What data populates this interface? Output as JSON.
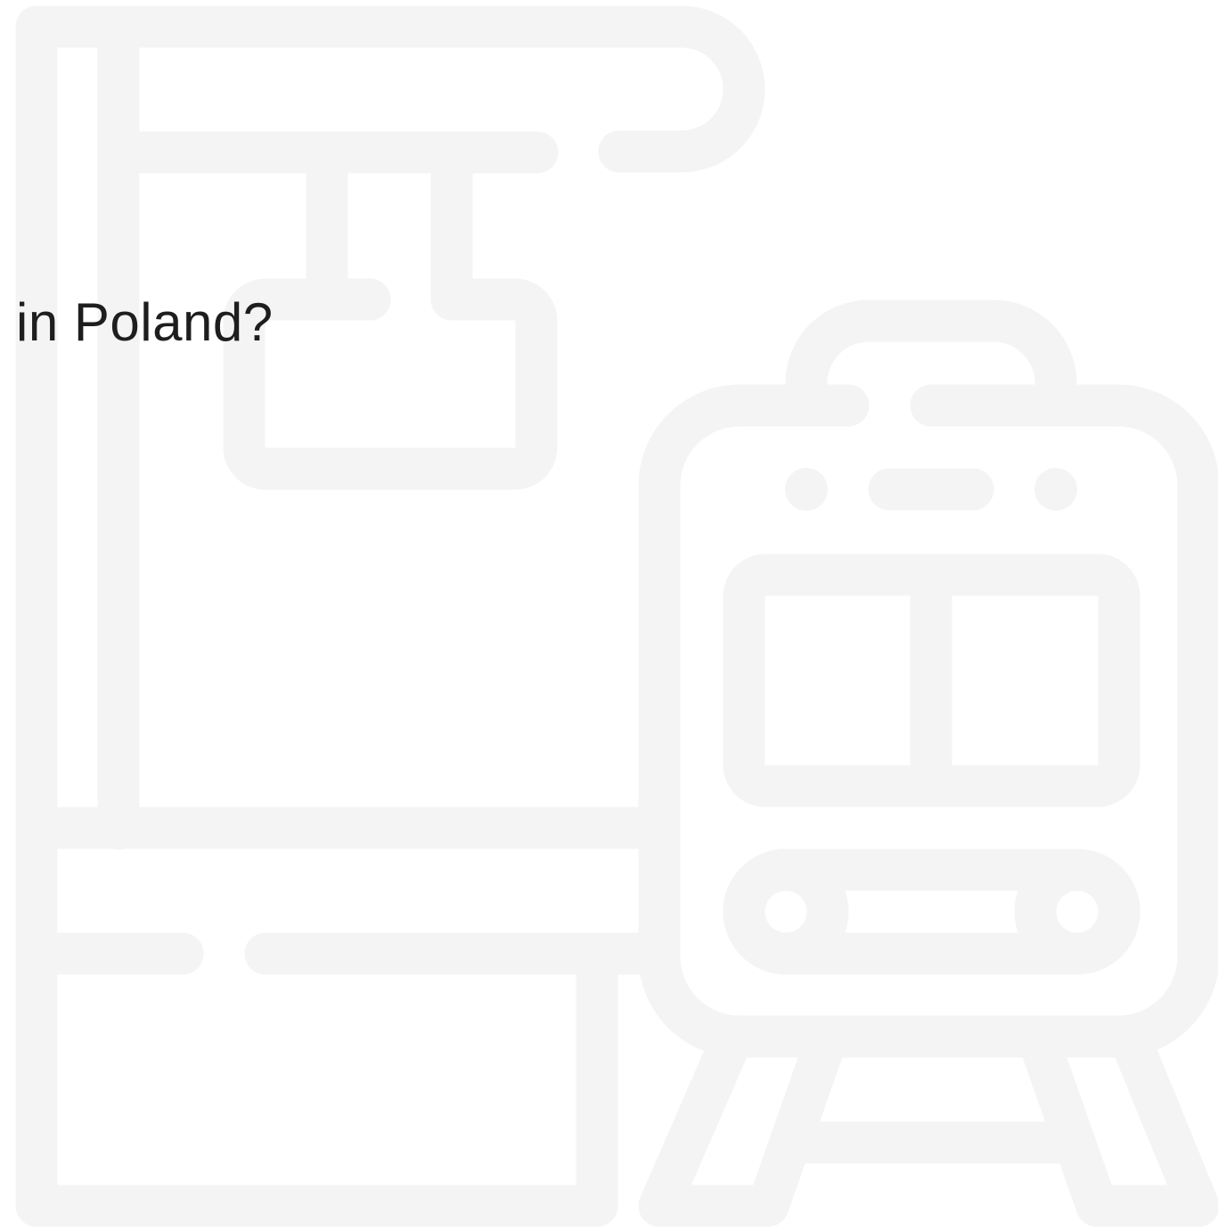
{
  "headline": {
    "text": "in Poland?"
  },
  "illustration": {
    "icon": "train-station-icon",
    "color": "#f4f4f4"
  },
  "colors": {
    "background": "#ffffff",
    "text": "#1e1e1e",
    "illustration": "#f4f4f4"
  }
}
